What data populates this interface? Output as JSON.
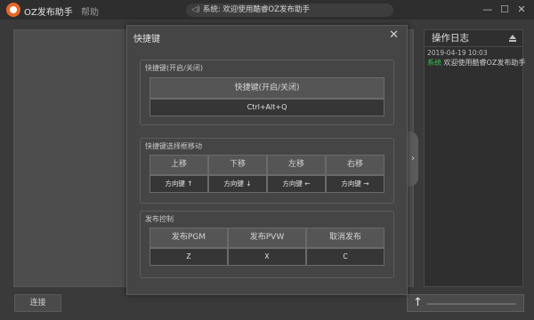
{
  "titlebar": {
    "app_title": "OZ发布助手",
    "menu_help": "帮助",
    "notice": "系统: 欢迎使用酷睿OZ发布助手",
    "min_icon": "minimize-icon",
    "max_icon": "maximize-icon",
    "close_icon": "close-icon"
  },
  "main": {
    "connect_button": "连接"
  },
  "log": {
    "title": "操作日志",
    "entries": [
      {
        "time": "2019-04-19 10:03",
        "source": "系统",
        "message": " 欢迎使用酷睿OZ发布助手"
      }
    ],
    "source_color": "#39c34a"
  },
  "dialog": {
    "title": "快捷键",
    "close": "✕",
    "toggle_group": {
      "label": "快捷键(开启/关闭)",
      "button": "快捷键(开启/关闭)",
      "key": "Ctrl+Alt+Q"
    },
    "move_group": {
      "label": "快捷键选择框移动",
      "buttons": [
        "上移",
        "下移",
        "左移",
        "右移"
      ],
      "keys": [
        "方向键 ↑",
        "方向键 ↓",
        "方向键 ←",
        "方向键 →"
      ]
    },
    "publish_group": {
      "label": "发布控制",
      "buttons": [
        "发布PGM",
        "发布PVW",
        "取消发布"
      ],
      "keys": [
        "Z",
        "X",
        "C"
      ]
    }
  }
}
